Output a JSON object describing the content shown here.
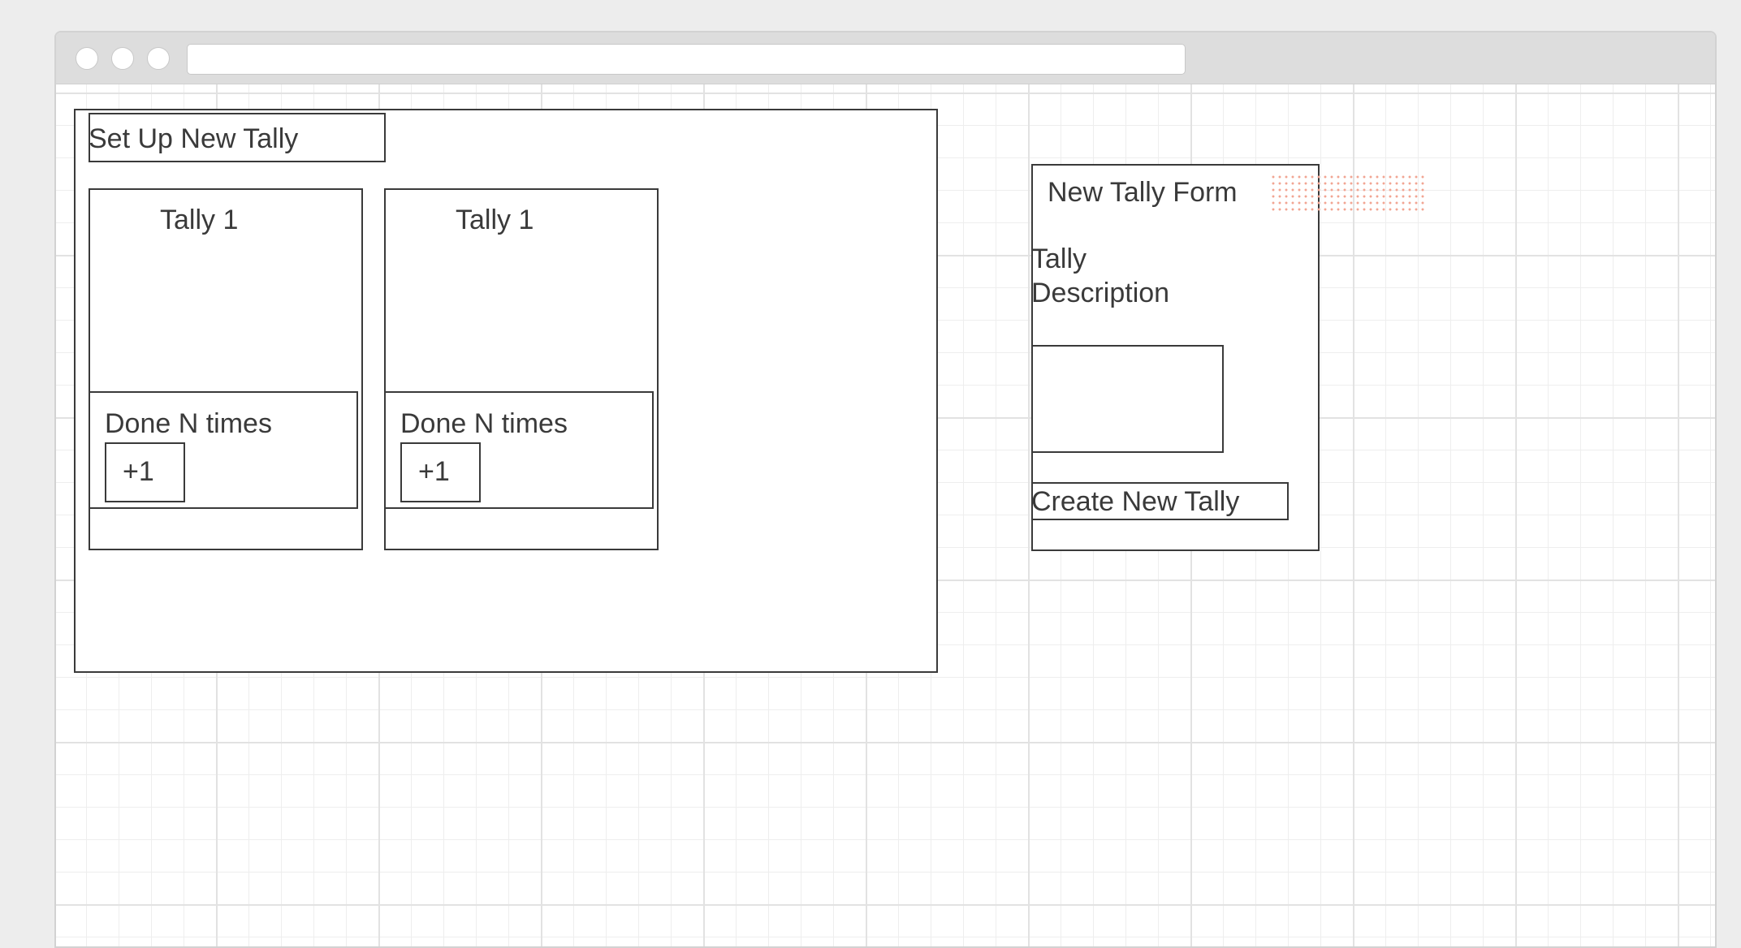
{
  "main_panel": {
    "setup_button_label": "Set Up New Tally",
    "tallies": [
      {
        "title": "Tally 1",
        "done_text": "Done N times",
        "increment_label": "+1"
      },
      {
        "title": "Tally 1",
        "done_text": "Done N times",
        "increment_label": "+1"
      }
    ]
  },
  "form": {
    "title": "New Tally Form",
    "description_label_line1": "Tally",
    "description_label_line2": "Description",
    "description_value": "",
    "submit_label": "Create New Tally"
  }
}
